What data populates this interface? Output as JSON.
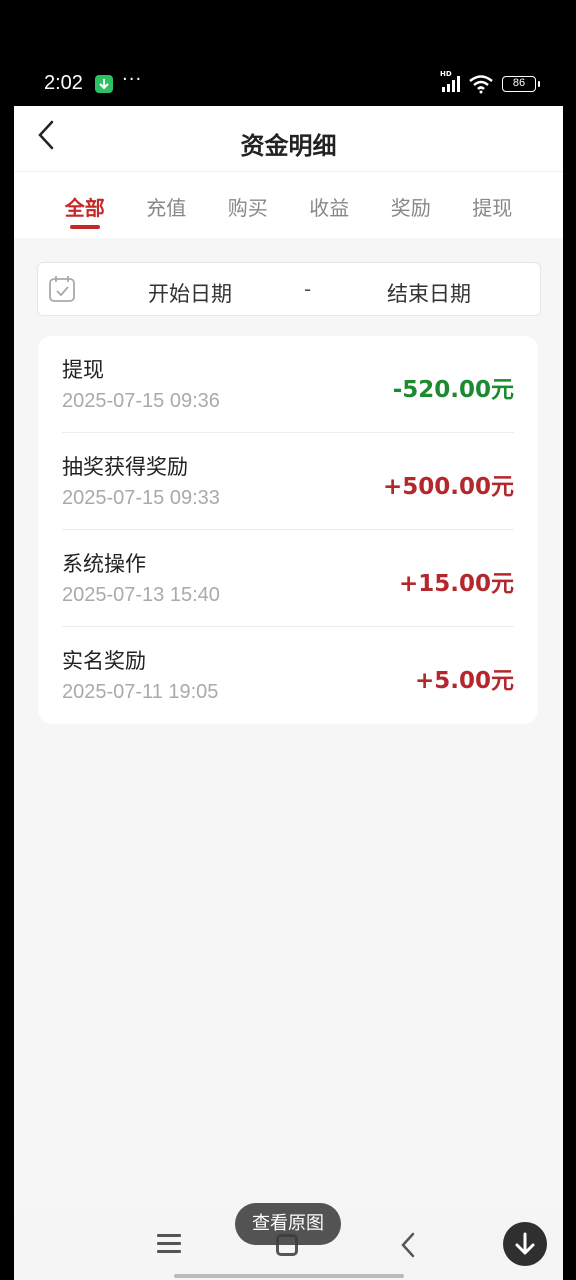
{
  "status_bar": {
    "time": "2:02",
    "battery": "86",
    "network": "HD",
    "dots": "···"
  },
  "header": {
    "title": "资金明细"
  },
  "tabs": [
    {
      "label": "全部",
      "active": true
    },
    {
      "label": "充值",
      "active": false
    },
    {
      "label": "购买",
      "active": false
    },
    {
      "label": "收益",
      "active": false
    },
    {
      "label": "奖励",
      "active": false
    },
    {
      "label": "提现",
      "active": false
    }
  ],
  "date_filter": {
    "start": "开始日期",
    "separator": "-",
    "end": "结束日期"
  },
  "transactions": [
    {
      "title": "提现",
      "time": "2025-07-15 09:36",
      "amount": "-520.00元",
      "sign": "negative"
    },
    {
      "title": "抽奖获得奖励",
      "time": "2025-07-15 09:33",
      "amount": "+500.00元",
      "sign": "positive"
    },
    {
      "title": "系统操作",
      "time": "2025-07-13 15:40",
      "amount": "+15.00元",
      "sign": "positive"
    },
    {
      "title": "实名奖励",
      "time": "2025-07-11 19:05",
      "amount": "+5.00元",
      "sign": "positive"
    }
  ],
  "overlay": {
    "view_original": "查看原图"
  },
  "colors": {
    "accent": "#c62828",
    "negative": "#1c8a2e",
    "positive": "#b4282d"
  }
}
